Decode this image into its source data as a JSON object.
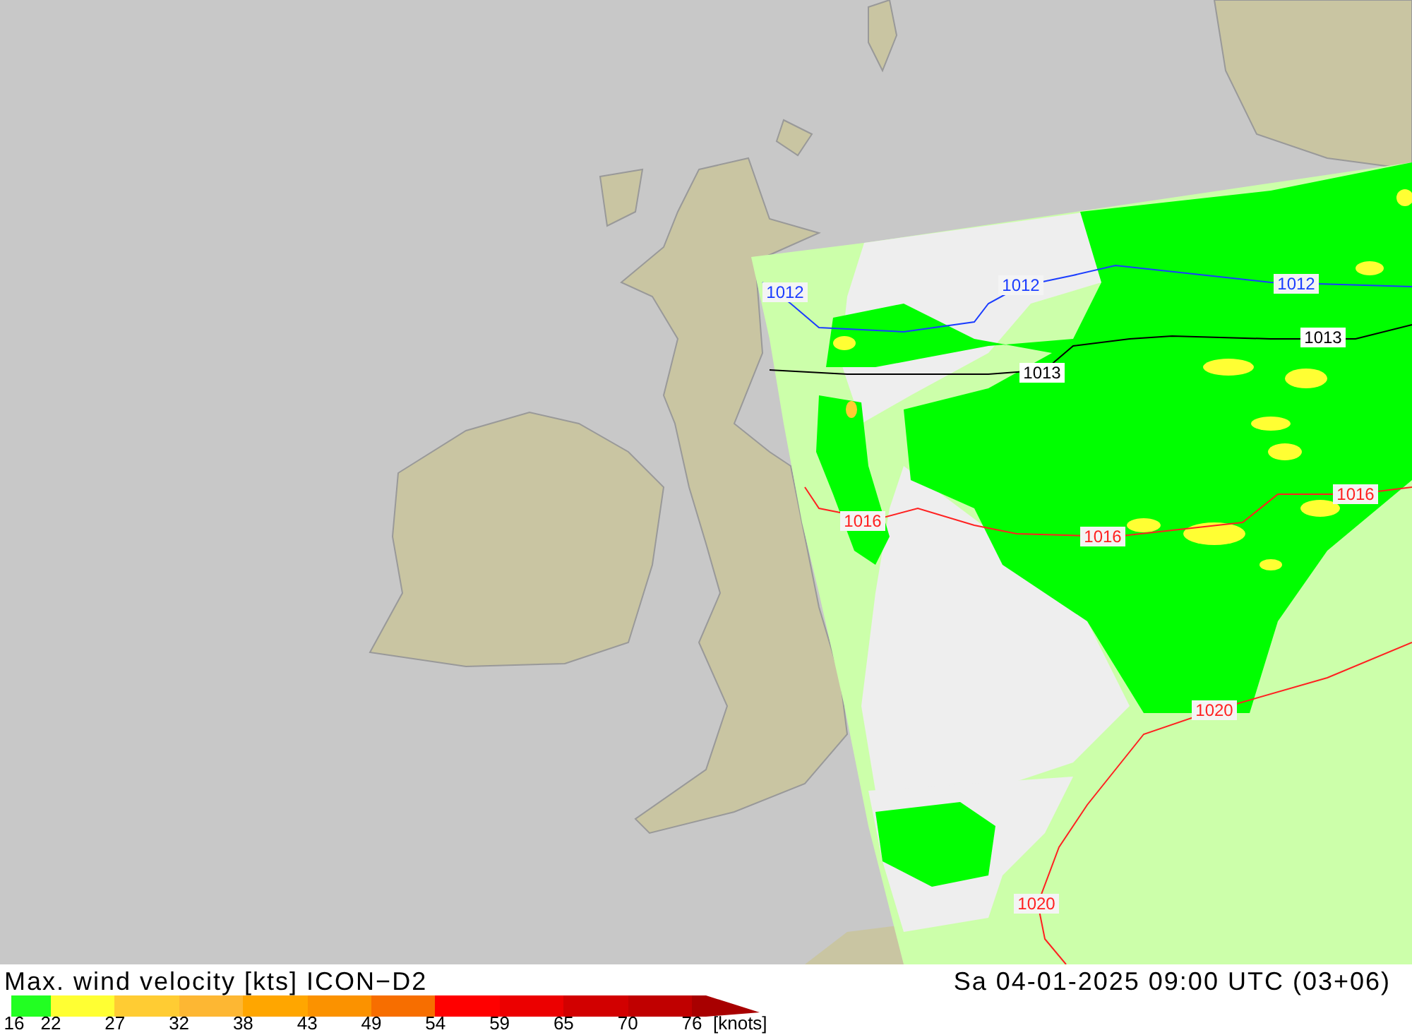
{
  "map": {
    "isobars": [
      {
        "kind": "blue",
        "labels": [
          "1012",
          "1012",
          "1012"
        ]
      },
      {
        "kind": "black",
        "labels": [
          "1013",
          "1013"
        ]
      },
      {
        "kind": "red",
        "labels": [
          "1016",
          "1016",
          "1016",
          "1020",
          "1020"
        ]
      }
    ]
  },
  "footer": {
    "title": "Max. wind velocity [kts] ICON−D2",
    "datetime": "Sa 04-01-2025 09:00 UTC (03+06)"
  },
  "legend": {
    "segments": [
      {
        "color": "#22ff22"
      },
      {
        "color": "#ffff33"
      },
      {
        "color": "#ffcc33"
      },
      {
        "color": "#fdb733"
      },
      {
        "color": "#ffa600"
      },
      {
        "color": "#fb9200"
      },
      {
        "color": "#f76e00"
      },
      {
        "color": "#ff0000"
      },
      {
        "color": "#ec0000"
      },
      {
        "color": "#d20000"
      },
      {
        "color": "#c00000"
      },
      {
        "color": "#a80000"
      }
    ],
    "ticks": [
      "16",
      "22",
      "27",
      "32",
      "38",
      "43",
      "49",
      "54",
      "59",
      "65",
      "70",
      "76"
    ],
    "unit": "[knots]"
  }
}
